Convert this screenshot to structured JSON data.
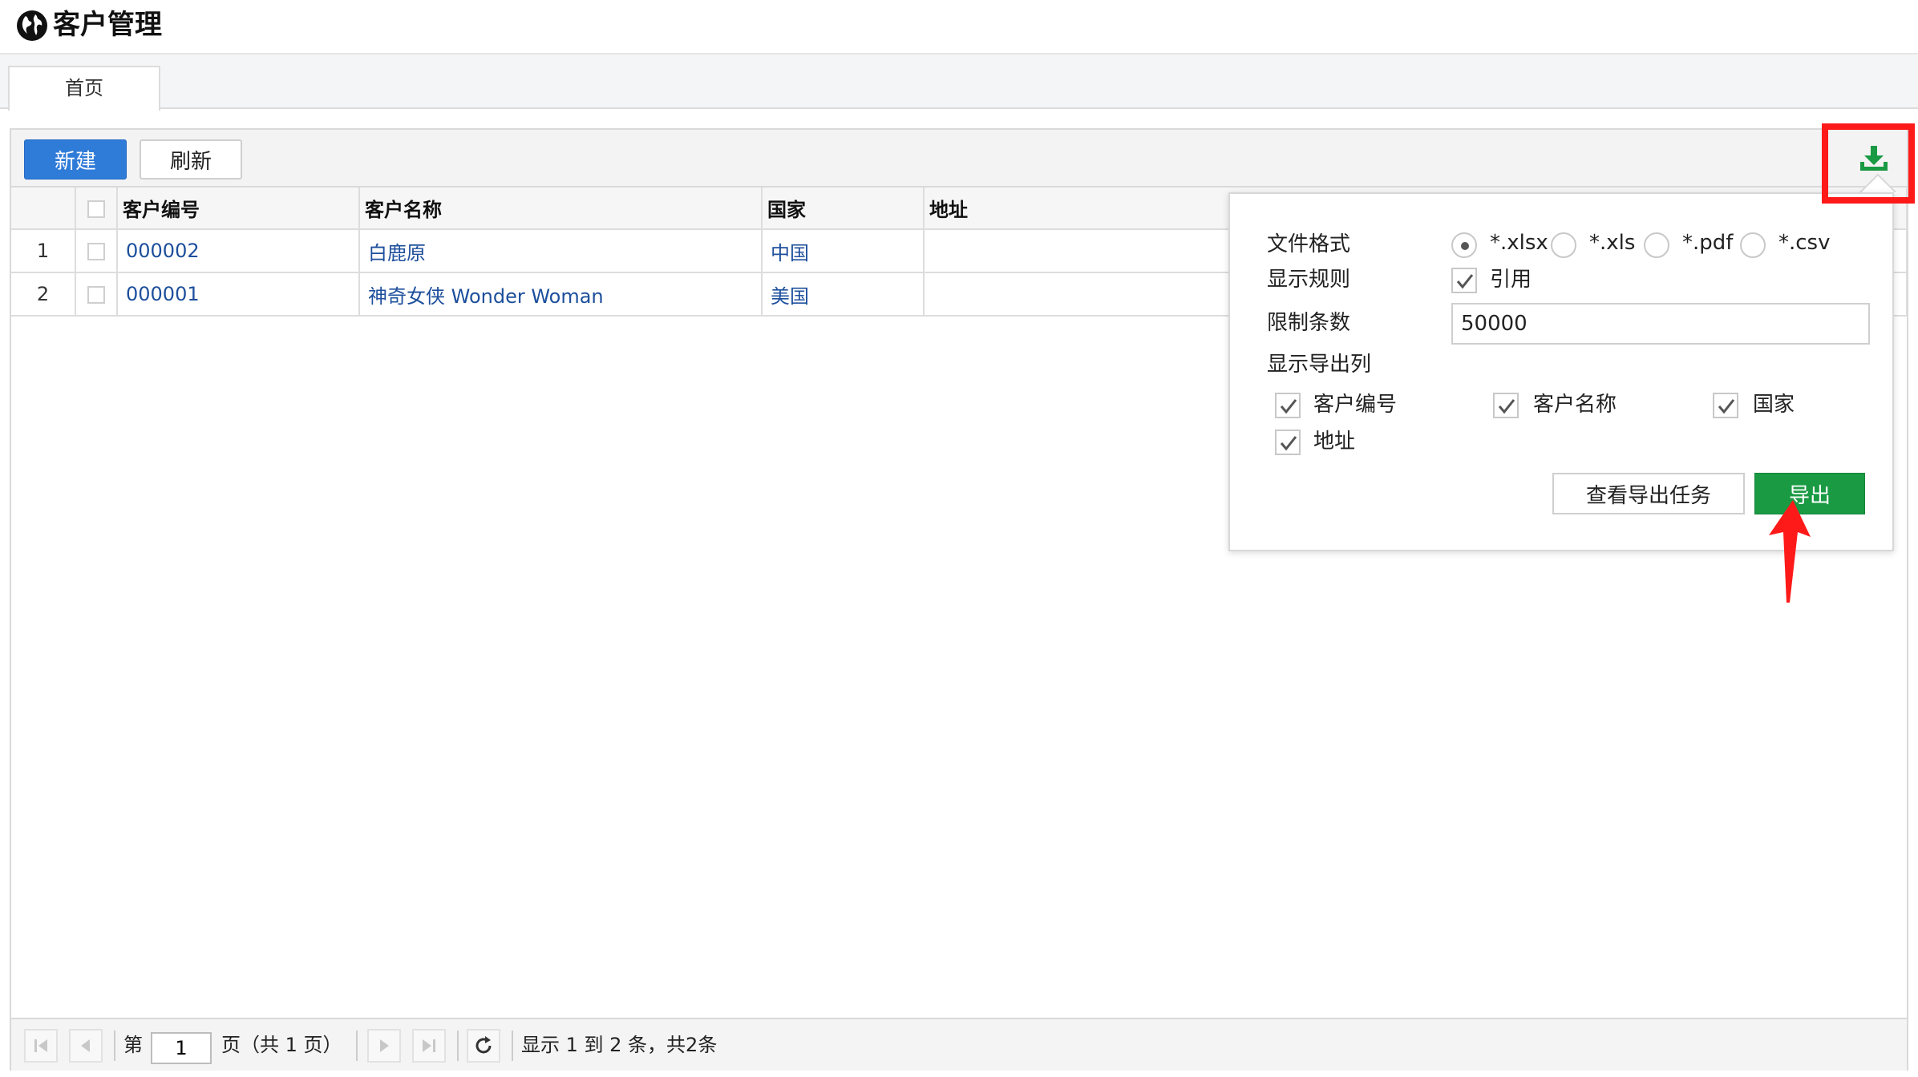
{
  "app": {
    "title": "客户管理",
    "logo_icon": "globe-icon"
  },
  "tabs": [
    {
      "label": "首页"
    }
  ],
  "toolbar": {
    "new_label": "新建",
    "refresh_label": "刷新",
    "export_icon": "download-icon"
  },
  "table": {
    "columns": [
      "客户编号",
      "客户名称",
      "国家",
      "地址"
    ],
    "rows": [
      {
        "index": "1",
        "code": "000002",
        "name": "白鹿原",
        "country": "中国",
        "address": ""
      },
      {
        "index": "2",
        "code": "000001",
        "name": "神奇女侠 Wonder Woman",
        "country": "美国",
        "address": ""
      }
    ]
  },
  "pager": {
    "page_prefix": "第",
    "current_page": "1",
    "page_suffix": "页（共 1 页）",
    "summary": "显示 1 到 2 条，共2条"
  },
  "export_panel": {
    "format_label": "文件格式",
    "formats": [
      {
        "label": "*.xlsx",
        "selected": true
      },
      {
        "label": "*.xls",
        "selected": false
      },
      {
        "label": "*.pdf",
        "selected": false
      },
      {
        "label": "*.csv",
        "selected": false
      }
    ],
    "rule_label": "显示规则",
    "rule_option": {
      "label": "引用",
      "checked": true
    },
    "limit_label": "限制条数",
    "limit_value": "50000",
    "columns_label": "显示导出列",
    "columns": [
      {
        "label": "客户编号",
        "checked": true
      },
      {
        "label": "客户名称",
        "checked": true
      },
      {
        "label": "国家",
        "checked": true
      },
      {
        "label": "地址",
        "checked": true
      }
    ],
    "view_tasks_label": "查看导出任务",
    "export_label": "导出"
  },
  "colors": {
    "primary": "#2f7bd8",
    "success": "#1a9a43",
    "annotation": "#ff1a1a",
    "link": "#1d4f9c"
  }
}
